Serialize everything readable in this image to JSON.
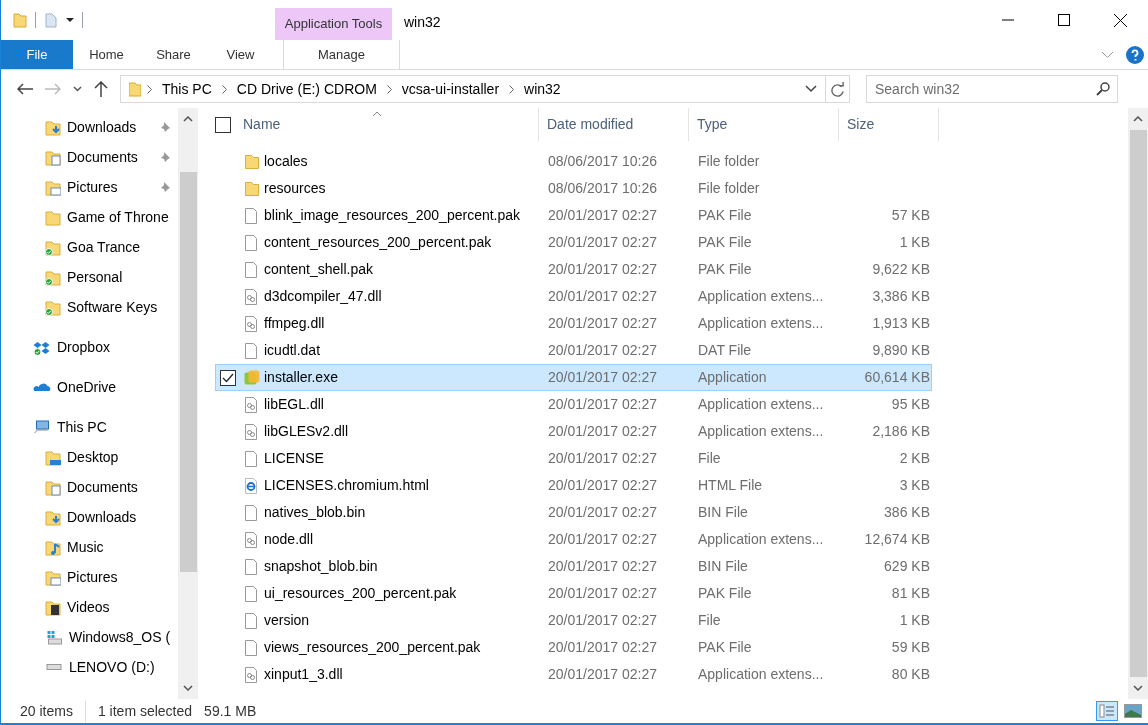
{
  "window": {
    "title": "win32",
    "context_tab_group": "Application Tools"
  },
  "ribbon_tabs": [
    {
      "label": "File",
      "kind": "file",
      "selected": false
    },
    {
      "label": "Home",
      "kind": "tab",
      "selected": false
    },
    {
      "label": "Share",
      "kind": "tab",
      "selected": false
    },
    {
      "label": "View",
      "kind": "tab",
      "selected": false
    },
    {
      "label": "Manage",
      "kind": "context",
      "selected": false
    }
  ],
  "address_bar": {
    "breadcrumbs": [
      "This PC",
      "CD Drive (E:) CDROM",
      "vcsa-ui-installer",
      "win32"
    ]
  },
  "search": {
    "placeholder": "Search win32"
  },
  "nav_pane": [
    {
      "label": "Downloads",
      "kind": "downloads",
      "pinned": true,
      "synced": false
    },
    {
      "label": "Documents",
      "kind": "documents",
      "pinned": true,
      "synced": false
    },
    {
      "label": "Pictures",
      "kind": "pictures",
      "pinned": true,
      "synced": false
    },
    {
      "label": "Game of Throne",
      "kind": "folder",
      "pinned": false,
      "synced": false
    },
    {
      "label": "Goa Trance",
      "kind": "folder",
      "pinned": false,
      "synced": true
    },
    {
      "label": "Personal",
      "kind": "folder",
      "pinned": false,
      "synced": true
    },
    {
      "label": "Software Keys",
      "kind": "folder",
      "pinned": false,
      "synced": true
    },
    {
      "label": "Dropbox",
      "kind": "dropbox",
      "pinned": false,
      "synced": true
    },
    {
      "label": "OneDrive",
      "kind": "onedrive",
      "pinned": false,
      "synced": false
    },
    {
      "label": "This PC",
      "kind": "pc",
      "pinned": false,
      "synced": false,
      "children": [
        {
          "label": "Desktop",
          "kind": "desktop",
          "pinned": false,
          "synced": false
        },
        {
          "label": "Documents",
          "kind": "documents",
          "pinned": false,
          "synced": false
        },
        {
          "label": "Downloads",
          "kind": "downloads",
          "pinned": false,
          "synced": false
        },
        {
          "label": "Music",
          "kind": "music",
          "pinned": false,
          "synced": false
        },
        {
          "label": "Pictures",
          "kind": "pictures",
          "pinned": false,
          "synced": false
        },
        {
          "label": "Videos",
          "kind": "videos",
          "pinned": false,
          "synced": false
        },
        {
          "label": "Windows8_OS (",
          "kind": "windrive",
          "pinned": false,
          "synced": false
        },
        {
          "label": "LENOVO (D:)",
          "kind": "drive",
          "pinned": false,
          "synced": false
        }
      ]
    }
  ],
  "table": {
    "select_all_checked": false,
    "columns": [
      "Name",
      "Date modified",
      "Type",
      "Size"
    ],
    "rows": [
      {
        "name": "locales",
        "date": "08/06/2017 10:26",
        "type": "File folder",
        "kind": "folder",
        "selected": false
      },
      {
        "name": "resources",
        "date": "08/06/2017 10:26",
        "type": "File folder",
        "kind": "folder",
        "selected": false
      },
      {
        "name": "blink_image_resources_200_percent.pak",
        "date": "20/01/2017 02:27",
        "type": "PAK File",
        "size": "57 KB",
        "kind": "file",
        "selected": false
      },
      {
        "name": "content_resources_200_percent.pak",
        "date": "20/01/2017 02:27",
        "type": "PAK File",
        "size": "1 KB",
        "kind": "file",
        "selected": false
      },
      {
        "name": "content_shell.pak",
        "date": "20/01/2017 02:27",
        "type": "PAK File",
        "size": "9,622 KB",
        "kind": "file",
        "selected": false
      },
      {
        "name": "d3dcompiler_47.dll",
        "date": "20/01/2017 02:27",
        "type": "Application extens...",
        "size": "3,386 KB",
        "kind": "dll",
        "selected": false
      },
      {
        "name": "ffmpeg.dll",
        "date": "20/01/2017 02:27",
        "type": "Application extens...",
        "size": "1,913 KB",
        "kind": "dll",
        "selected": false
      },
      {
        "name": "icudtl.dat",
        "date": "20/01/2017 02:27",
        "type": "DAT File",
        "size": "9,890 KB",
        "kind": "file",
        "selected": false
      },
      {
        "name": "installer.exe",
        "date": "20/01/2017 02:27",
        "type": "Application",
        "size": "60,614 KB",
        "kind": "exe",
        "selected": true
      },
      {
        "name": "libEGL.dll",
        "date": "20/01/2017 02:27",
        "type": "Application extens...",
        "size": "95 KB",
        "kind": "dll",
        "selected": false
      },
      {
        "name": "libGLESv2.dll",
        "date": "20/01/2017 02:27",
        "type": "Application extens...",
        "size": "2,186 KB",
        "kind": "dll",
        "selected": false
      },
      {
        "name": "LICENSE",
        "date": "20/01/2017 02:27",
        "type": "File",
        "size": "2 KB",
        "kind": "file",
        "selected": false
      },
      {
        "name": "LICENSES.chromium.html",
        "date": "20/01/2017 02:27",
        "type": "HTML File",
        "size": "3 KB",
        "kind": "html",
        "selected": false
      },
      {
        "name": "natives_blob.bin",
        "date": "20/01/2017 02:27",
        "type": "BIN File",
        "size": "386 KB",
        "kind": "file",
        "selected": false
      },
      {
        "name": "node.dll",
        "date": "20/01/2017 02:27",
        "type": "Application extens...",
        "size": "12,674 KB",
        "kind": "dll",
        "selected": false
      },
      {
        "name": "snapshot_blob.bin",
        "date": "20/01/2017 02:27",
        "type": "BIN File",
        "size": "629 KB",
        "kind": "file",
        "selected": false
      },
      {
        "name": "ui_resources_200_percent.pak",
        "date": "20/01/2017 02:27",
        "type": "PAK File",
        "size": "81 KB",
        "kind": "file",
        "selected": false
      },
      {
        "name": "version",
        "date": "20/01/2017 02:27",
        "type": "File",
        "size": "1 KB",
        "kind": "file",
        "selected": false
      },
      {
        "name": "views_resources_200_percent.pak",
        "date": "20/01/2017 02:27",
        "type": "PAK File",
        "size": "59 KB",
        "kind": "file",
        "selected": false
      },
      {
        "name": "xinput1_3.dll",
        "date": "20/01/2017 02:27",
        "type": "Application extens...",
        "size": "80 KB",
        "kind": "dll",
        "selected": false
      }
    ]
  },
  "status_bar": {
    "item_count": "20 items",
    "selection": "1 item selected",
    "selection_size": "59.1 MB"
  },
  "view_buttons": [
    {
      "kind": "details",
      "selected": true
    },
    {
      "kind": "thumbnails",
      "selected": false
    }
  ]
}
